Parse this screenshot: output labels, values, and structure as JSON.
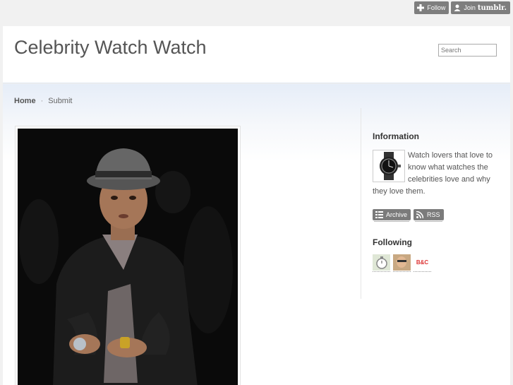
{
  "tumblr": {
    "follow_label": "Follow",
    "join_label": "Join",
    "brand": "tumblr."
  },
  "header": {
    "title": "Celebrity Watch Watch",
    "search_placeholder": "Search"
  },
  "nav": {
    "home": "Home",
    "separator": "·",
    "submit": "Submit"
  },
  "sidebar": {
    "information_heading": "Information",
    "description": "Watch lovers that love to know what watches the celebrities love and why they love them.",
    "archive_label": "Archive",
    "rss_label": "RSS",
    "following_heading": "Following",
    "following": [
      {
        "name": "watch-blog-avatar-1",
        "icon": "watch-face-icon"
      },
      {
        "name": "watch-blog-avatar-2",
        "icon": "person-photo-icon"
      },
      {
        "name": "watch-blog-avatar-3",
        "text": "B&C"
      }
    ]
  },
  "colors": {
    "button_gray": "#7e7e7e",
    "page_bg": "#f1f1f1",
    "title": "#555555"
  }
}
